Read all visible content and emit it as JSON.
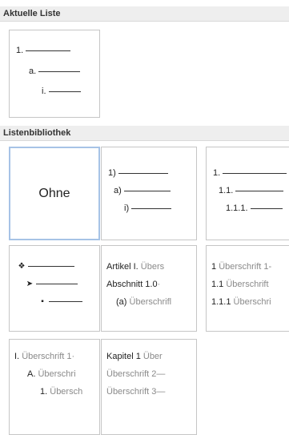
{
  "current_list": {
    "header": "Aktuelle Liste",
    "levels": [
      "1.",
      "a.",
      "i."
    ]
  },
  "library": {
    "header": "Listenbibliothek",
    "none_label": "Ohne",
    "numbered_paren": [
      "1)",
      "a)",
      "i)"
    ],
    "numbered_legal": [
      "1.",
      "1.1.",
      "1.1.1."
    ],
    "bullets": [
      "diamond-bullet",
      "arrow-bullet",
      "square-bullet"
    ],
    "article": [
      {
        "prefix": "Artikel I.",
        "text": "Übers"
      },
      {
        "prefix": "Abschnitt 1.0",
        "text": "·"
      },
      {
        "prefix": "(a)",
        "text": "Überschrifl"
      }
    ],
    "heading_numbered": [
      {
        "prefix": "1",
        "text": "Überschrift 1-"
      },
      {
        "prefix": "1.1",
        "text": "Überschrift"
      },
      {
        "prefix": "1.1.1",
        "text": "Überschri"
      }
    ],
    "roman_heading": [
      {
        "prefix": "I.",
        "text": "Überschrift 1·"
      },
      {
        "prefix": "A.",
        "text": "Überschri"
      },
      {
        "prefix": "1.",
        "text": "Übersch"
      }
    ],
    "chapter": [
      {
        "prefix": "Kapitel 1",
        "text": "Über"
      },
      {
        "prefix": "",
        "text": "Überschrift 2—"
      },
      {
        "prefix": "",
        "text": "Überschrift 3—"
      }
    ]
  }
}
